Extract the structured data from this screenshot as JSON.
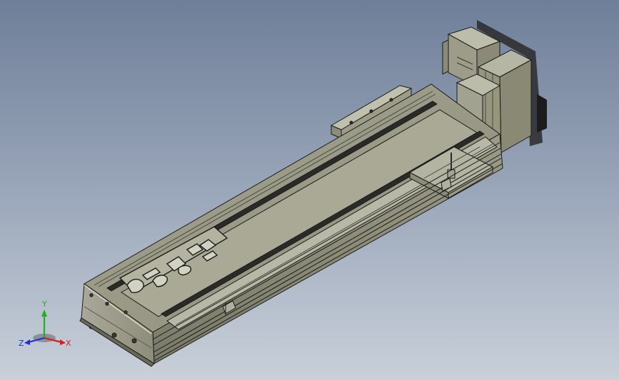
{
  "viewport": {
    "background_top": "#6f7f99",
    "background_bottom": "#c9d0da"
  },
  "model": {
    "body_color": "#9a9a86",
    "edge_color": "#1b1b1b",
    "slot_color": "#2a2a28",
    "highlight_color": "#c8c8b8",
    "logo_icon": "logo-emboss-icon"
  },
  "triad": {
    "x_label": "X",
    "y_label": "Y",
    "z_label": "Z",
    "x_color": "#d42020",
    "y_color": "#20b020",
    "z_color": "#2030d0"
  }
}
